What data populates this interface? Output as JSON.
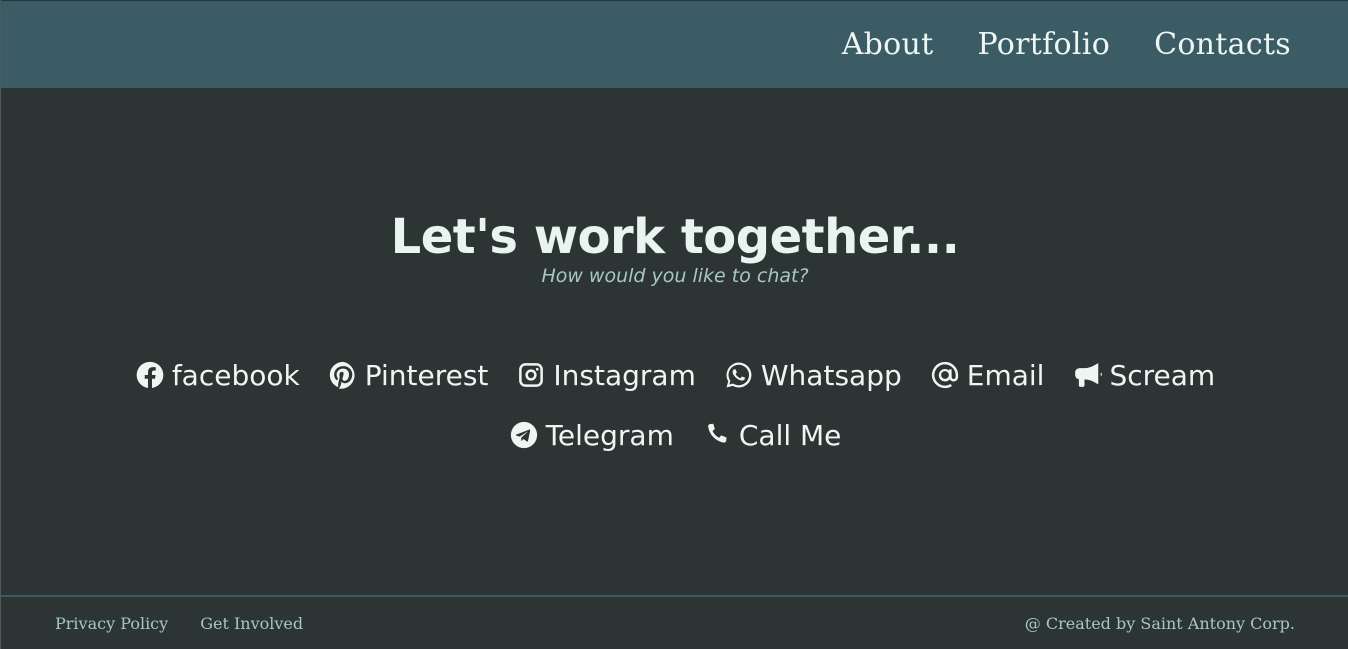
{
  "nav": {
    "items": [
      {
        "label": "About"
      },
      {
        "label": "Portfolio"
      },
      {
        "label": "Contacts"
      }
    ]
  },
  "hero": {
    "title": "Let's work together...",
    "subtitle": "How would you like to chat?"
  },
  "contacts": {
    "row1": [
      {
        "label": "facebook",
        "icon": "facebook-icon"
      },
      {
        "label": "Pinterest",
        "icon": "pinterest-icon"
      },
      {
        "label": "Instagram",
        "icon": "instagram-icon"
      },
      {
        "label": "Whatsapp",
        "icon": "whatsapp-icon"
      },
      {
        "label": "Email",
        "icon": "at-icon"
      },
      {
        "label": "Scream",
        "icon": "megaphone-icon"
      }
    ],
    "row2": [
      {
        "label": "Telegram",
        "icon": "telegram-icon"
      },
      {
        "label": "Call Me",
        "icon": "phone-icon"
      }
    ]
  },
  "footer": {
    "links": [
      {
        "label": "Privacy Policy"
      },
      {
        "label": "Get Involved"
      }
    ],
    "copyright": "@ Created by Saint Antony Corp."
  },
  "colors": {
    "background": "#2c3434",
    "header": "#3b5c65",
    "text": "#eef6f4",
    "muted": "#a9c6c6"
  }
}
